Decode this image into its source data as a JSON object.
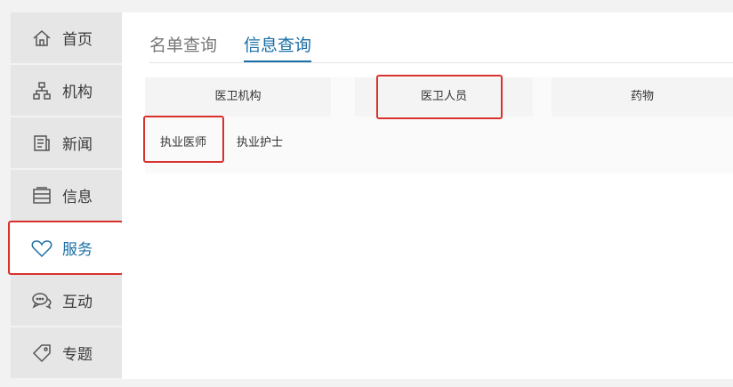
{
  "sidebar": {
    "items": [
      {
        "label": "首页",
        "icon": "home-icon"
      },
      {
        "label": "机构",
        "icon": "org-icon"
      },
      {
        "label": "新闻",
        "icon": "news-icon"
      },
      {
        "label": "信息",
        "icon": "info-icon"
      },
      {
        "label": "服务",
        "icon": "heart-icon",
        "active": true
      },
      {
        "label": "互动",
        "icon": "chat-icon"
      },
      {
        "label": "专题",
        "icon": "tag-icon"
      }
    ]
  },
  "main": {
    "tabs": [
      {
        "label": "名单查询"
      },
      {
        "label": "信息查询",
        "active": true
      }
    ],
    "categories": [
      {
        "label": "医卫机构"
      },
      {
        "label": "医卫人员",
        "active": true
      },
      {
        "label": "药物"
      }
    ],
    "subcategories": [
      {
        "label": "执业医师",
        "active": true
      },
      {
        "label": "执业护士"
      }
    ]
  },
  "colors": {
    "accent": "#1b6fa6",
    "highlight": "#d8322e"
  }
}
